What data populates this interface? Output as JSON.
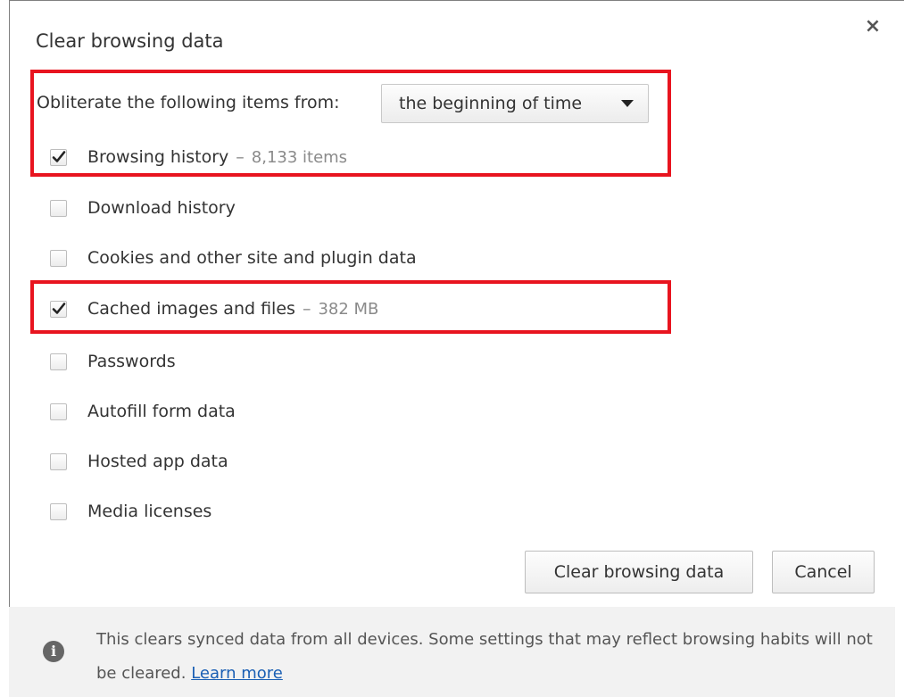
{
  "dialog": {
    "title": "Clear browsing data",
    "close_label": "×"
  },
  "period": {
    "label": "Obliterate the following items from:",
    "selected": "the beginning of time"
  },
  "items": [
    {
      "label": "Browsing history",
      "checked": true,
      "meta": "8,133 items"
    },
    {
      "label": "Download history",
      "checked": false
    },
    {
      "label": "Cookies and other site and plugin data",
      "checked": false
    },
    {
      "label": "Cached images and files",
      "checked": true,
      "meta": "382 MB"
    },
    {
      "label": "Passwords",
      "checked": false
    },
    {
      "label": "Autofill form data",
      "checked": false
    },
    {
      "label": "Hosted app data",
      "checked": false
    },
    {
      "label": "Media licenses",
      "checked": false
    }
  ],
  "separator": "–",
  "buttons": {
    "clear": "Clear browsing data",
    "cancel": "Cancel"
  },
  "footer": {
    "text": "This clears synced data from all devices. Some settings that may reflect browsing habits will not be cleared.",
    "link": "Learn more",
    "icon": "info-icon"
  },
  "colors": {
    "highlight": "#e8141f",
    "link": "#1a5fb4"
  }
}
